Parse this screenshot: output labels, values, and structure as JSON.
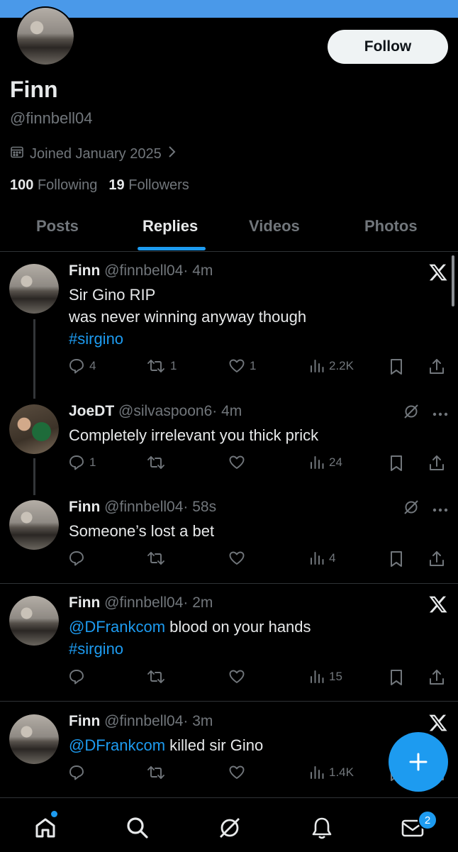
{
  "profile": {
    "name": "Finn",
    "handle": "@finnbell04",
    "follow_label": "Follow",
    "joined": "Joined January 2025",
    "following_count": "100",
    "following_label": "Following",
    "followers_count": "19",
    "followers_label": "Followers"
  },
  "tabs": [
    {
      "label": "Posts",
      "active": false
    },
    {
      "label": "Replies",
      "active": true
    },
    {
      "label": "Videos",
      "active": false
    },
    {
      "label": "Photos",
      "active": false
    }
  ],
  "tweets": [
    {
      "name": "Finn",
      "handle": "@finnbell04",
      "time": "· 4m",
      "lines": [
        "Sir Gino RIP",
        "was never winning anyway though"
      ],
      "hashtag": "#sirgino",
      "replies": "4",
      "reposts": "1",
      "likes": "1",
      "views": "2.2K"
    },
    {
      "name": "JoeDT",
      "handle": "@silvaspoon6",
      "time": "· 4m",
      "text": "Completely irrelevant you thick prick",
      "replies": "1",
      "reposts": "",
      "likes": "",
      "views": "24"
    },
    {
      "name": "Finn",
      "handle": "@finnbell04",
      "time": "· 58s",
      "text": "Someone’s lost a bet",
      "replies": "",
      "reposts": "",
      "likes": "",
      "views": "4"
    },
    {
      "name": "Finn",
      "handle": "@finnbell04",
      "time": "· 2m",
      "mention": "@DFrankcom",
      "text": " blood on your hands",
      "hashtag": "#sirgino",
      "replies": "",
      "reposts": "",
      "likes": "",
      "views": "15"
    },
    {
      "name": "Finn",
      "handle": "@finnbell04",
      "time": "· 3m",
      "mention": "@DFrankcom",
      "text": " killed sir Gino",
      "replies": "",
      "reposts": "",
      "likes": "",
      "views": "1.4K"
    }
  ],
  "notifications_badge": "2",
  "colors": {
    "accent": "#1d9bf0",
    "background": "#000000",
    "text_primary": "#e7e9ea",
    "text_secondary": "#71767b",
    "topbar": "#4a99e9"
  },
  "icons": [
    "calendar-icon",
    "chevron-right-icon",
    "reply-icon",
    "repost-icon",
    "like-icon",
    "views-icon",
    "bookmark-icon",
    "share-icon",
    "x-logo-icon",
    "grok-icon",
    "more-icon",
    "plus-icon",
    "home-icon",
    "search-icon",
    "bell-icon",
    "mail-icon"
  ]
}
